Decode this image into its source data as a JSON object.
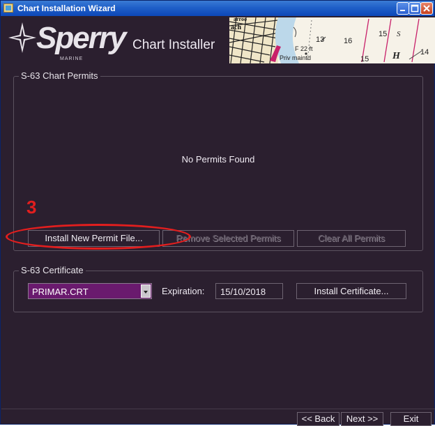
{
  "window": {
    "title": "Chart Installation Wizard"
  },
  "header": {
    "logo_text": "Sperry",
    "logo_sub": "MARINE",
    "app_title": "Chart Installer",
    "chart_snippet_text": [
      "arroo",
      "ach",
      "13",
      "16",
      "15",
      "S",
      "F 22 ft",
      "14",
      "Priv maintd",
      "15",
      "H"
    ]
  },
  "permits": {
    "group_label": "S-63 Chart Permits",
    "empty_message": "No Permits Found",
    "install_button": "Install New Permit File...",
    "remove_button": "Remove Selected Permits",
    "clear_button": "Clear All Permits"
  },
  "certificate": {
    "group_label": "S-63 Certificate",
    "selected_file": "PRIMAR.CRT",
    "expiration_label": "Expiration:",
    "expiration_value": "15/10/2018",
    "install_button": "Install Certificate..."
  },
  "annotation": {
    "step_number": "3",
    "color": "#e21e1e"
  },
  "footer": {
    "back_button": "<< Back",
    "next_button": "Next >>",
    "exit_button": "Exit"
  },
  "colors": {
    "background": "#2b1f2f",
    "combo_bg": "#6a1a6e",
    "titlebar": "#1f5fc8"
  }
}
